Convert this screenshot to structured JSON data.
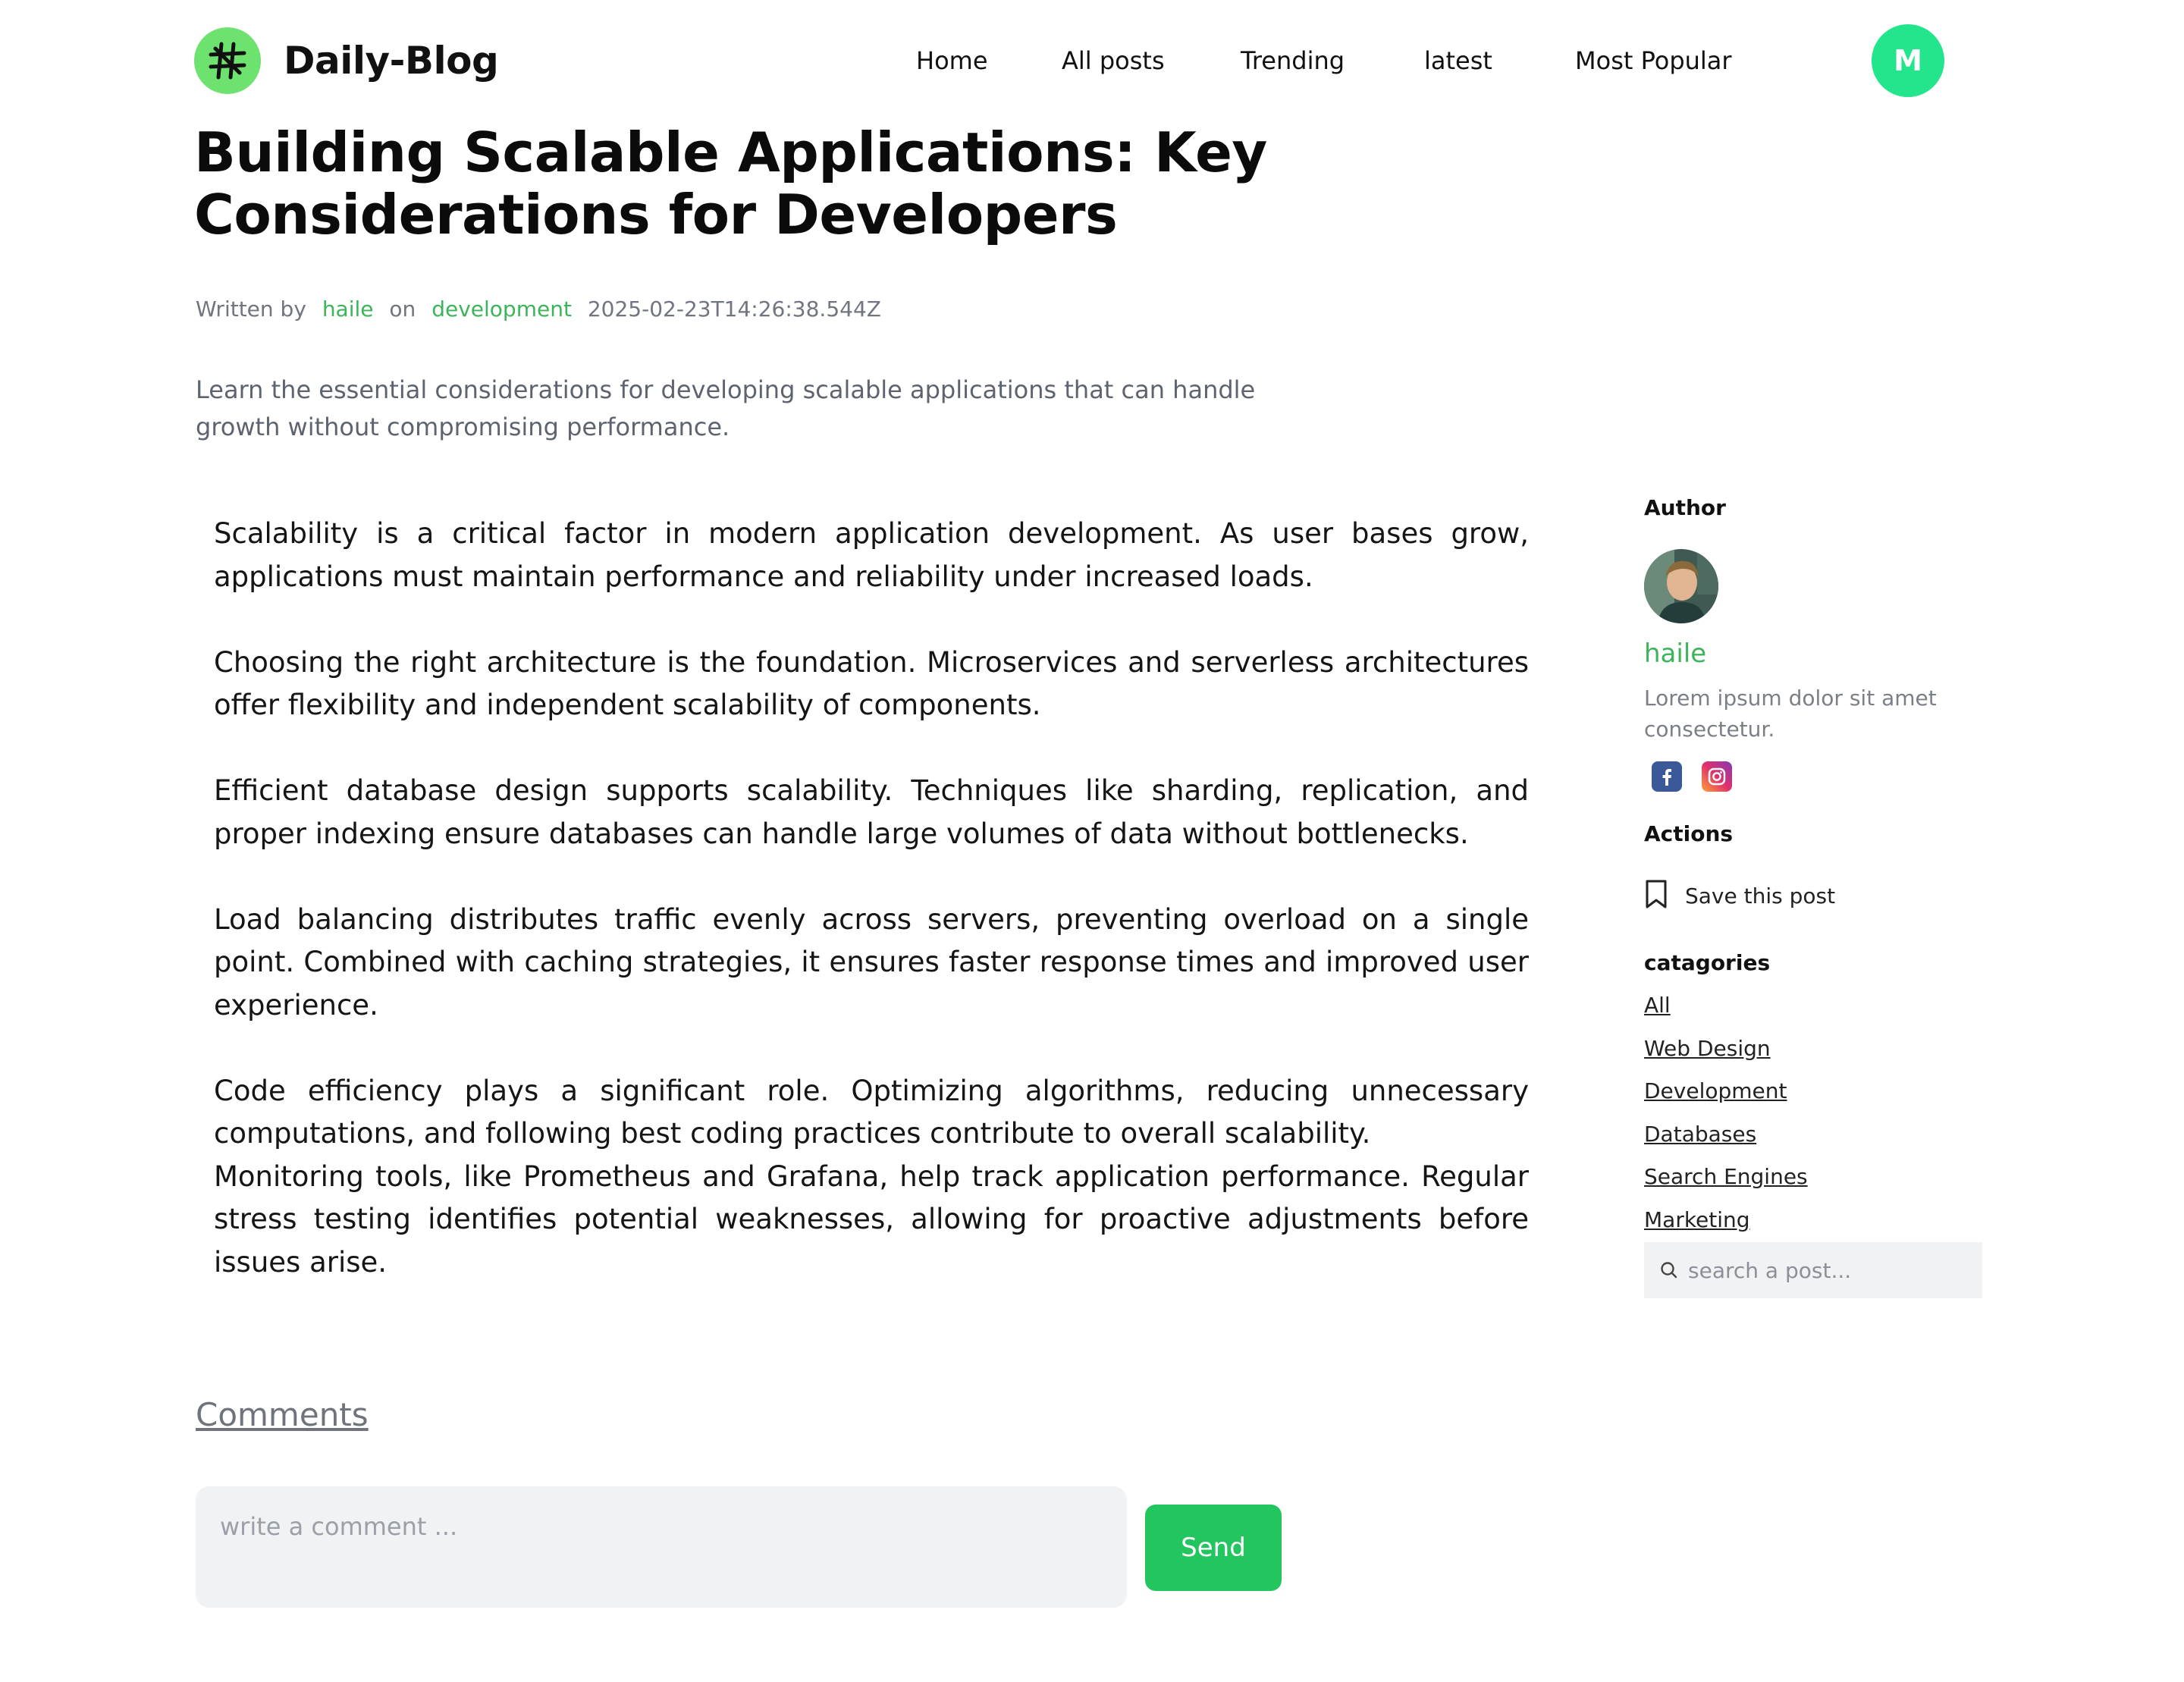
{
  "header": {
    "logo_text": "Daily-Blog",
    "nav": [
      "Home",
      "All posts",
      "Trending",
      "latest",
      "Most Popular"
    ],
    "avatar_initial": "M"
  },
  "post": {
    "title": "Building Scalable Applications: Key Considerations for Developers",
    "meta": {
      "written_by": "Written by",
      "author": "haile",
      "on": "on",
      "category": "development",
      "timestamp": "2025-02-23T14:26:38.544Z"
    },
    "lead": "Learn the essential considerations for developing scalable applications that can handle growth without compromising performance.",
    "paragraphs": [
      "Scalability is a critical factor in modern application development. As user bases grow, applications must maintain performance and reliability under increased loads.",
      "Choosing the right architecture is the foundation. Microservices and serverless architectures offer flexibility and independent scalability of components.",
      "Efficient database design supports scalability. Techniques like sharding, replication, and proper indexing ensure databases can handle large volumes of data without bottlenecks.",
      "Load balancing distributes traffic evenly across servers, preventing overload on a single point. Combined with caching strategies, it ensures faster response times and improved user experience.",
      "Code efficiency plays a significant role. Optimizing algorithms, reducing unnecessary computations, and following best coding practices contribute to overall scalability.",
      "Monitoring tools, like Prometheus and Grafana, help track application performance. Regular stress testing identifies potential weaknesses, allowing for proactive adjustments before issues arise."
    ]
  },
  "sidebar": {
    "author_heading": "Author",
    "author_name": "haile",
    "author_bio": "Lorem ipsum dolor sit amet consectetur.",
    "social_icons": [
      "facebook-icon",
      "instagram-icon"
    ],
    "actions_heading": "Actions",
    "save_label": "Save this post",
    "categories_heading": "catagories",
    "categories": [
      "All",
      "Web Design",
      "Development",
      "Databases",
      "Search Engines",
      "Marketing"
    ],
    "search_placeholder": "search a post..."
  },
  "comments": {
    "heading": "Comments",
    "placeholder": "write a comment ...",
    "send_label": "Send"
  },
  "colors": {
    "accent_green": "#3cb55a",
    "send_button": "#22c55e",
    "avatar_bg": "#22e58c",
    "logo_bg": "#6ee26e"
  }
}
